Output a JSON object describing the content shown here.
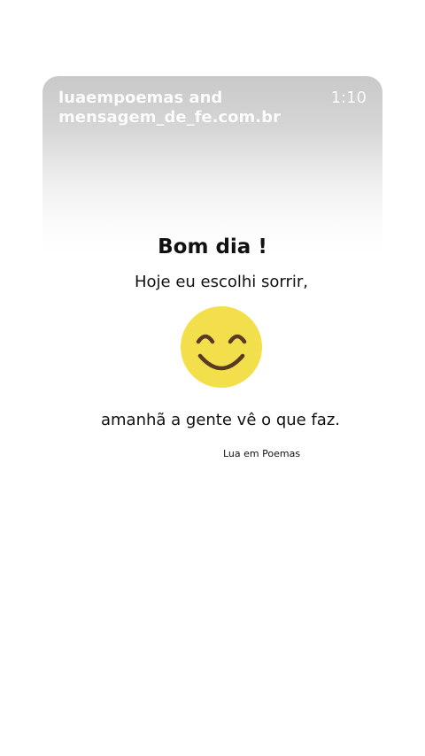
{
  "card": {
    "source_line1": "luaempoemas and",
    "source_line2": "mensagem_de_fe.com.br",
    "time": "1:10"
  },
  "message": {
    "greeting": "Bom dia !",
    "line1": "Hoje eu escolhi sorrir,",
    "line2": "amanhã a gente vê o que faz.",
    "author": "Lua em Poemas"
  },
  "icons": {
    "emoji": "smiling-face-icon"
  },
  "colors": {
    "emoji_face": "#f2df4b",
    "emoji_features": "#5a3a22"
  }
}
